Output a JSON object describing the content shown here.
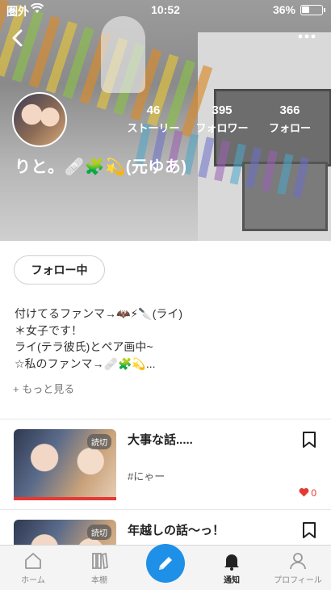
{
  "status": {
    "carrier": "圏外",
    "time": "10:52",
    "battery": "36%"
  },
  "profile": {
    "name": "りと。🩹🧩💫(元ゆあ)",
    "stats": [
      {
        "value": "46",
        "label": "ストーリー"
      },
      {
        "value": "395",
        "label": "フォロワー"
      },
      {
        "value": "366",
        "label": "フォロー"
      }
    ],
    "follow_label": "フォロー中",
    "bio_lines": [
      "付けてるファンマ→🦇⚡🔪(ライ)",
      "＊女子です！",
      "ライ(テラ彼氏)とペア画中~",
      "☆私のファンマ→🩹🧩💫..."
    ],
    "more_label": "+ もっと見る"
  },
  "stories": [
    {
      "title": "大事な話.....",
      "tag": "#にゃー",
      "badge": "読切",
      "likes": "0"
    },
    {
      "title": "年越しの話〜っ！",
      "tag": "",
      "badge": "読切",
      "likes": ""
    }
  ],
  "tabs": [
    {
      "label": "ホーム",
      "icon": "home-icon"
    },
    {
      "label": "本棚",
      "icon": "bookshelf-icon"
    },
    {
      "label": "",
      "icon": "pencil-icon"
    },
    {
      "label": "通知",
      "icon": "bell-icon"
    },
    {
      "label": "プロフィール",
      "icon": "person-icon"
    }
  ],
  "colors": {
    "accent": "#1e90e8",
    "like": "#e53935"
  }
}
